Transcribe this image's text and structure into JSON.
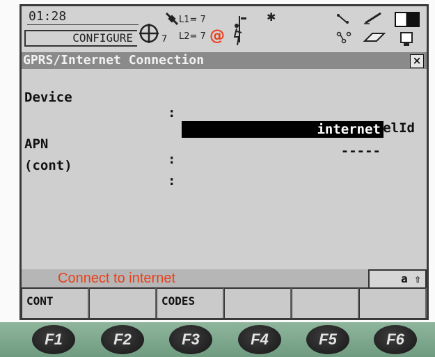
{
  "status": {
    "time": "01:28",
    "mode": "CONFIGURE",
    "sat_l1": "L1= 7",
    "sat_l2": "L2= 7",
    "sat_count": "7",
    "at_symbol": "@"
  },
  "dialog": {
    "title": "GPRS/Internet Connection",
    "close": "×"
  },
  "fields": {
    "device_label": "Device",
    "device_colon": ":",
    "device_value": "Manufact ModelId",
    "apn_label": "APN",
    "apn_colon": ":",
    "apn_value": "internet",
    "cont_label": "(cont)",
    "cont_colon": ":",
    "cont_value": "-----"
  },
  "message": "Connect to internet",
  "input_mode": "a ⇧",
  "softkeys": [
    "CONT",
    "",
    "CODES",
    "",
    "",
    ""
  ],
  "fkeys": [
    "F1",
    "F2",
    "F3",
    "F4",
    "F5",
    "F6"
  ],
  "colors": {
    "accent": "#e8401c",
    "title_bg": "#8a8a8a",
    "lcd_bg": "#cfcfcf",
    "fkey_strip": "#7da88d"
  }
}
